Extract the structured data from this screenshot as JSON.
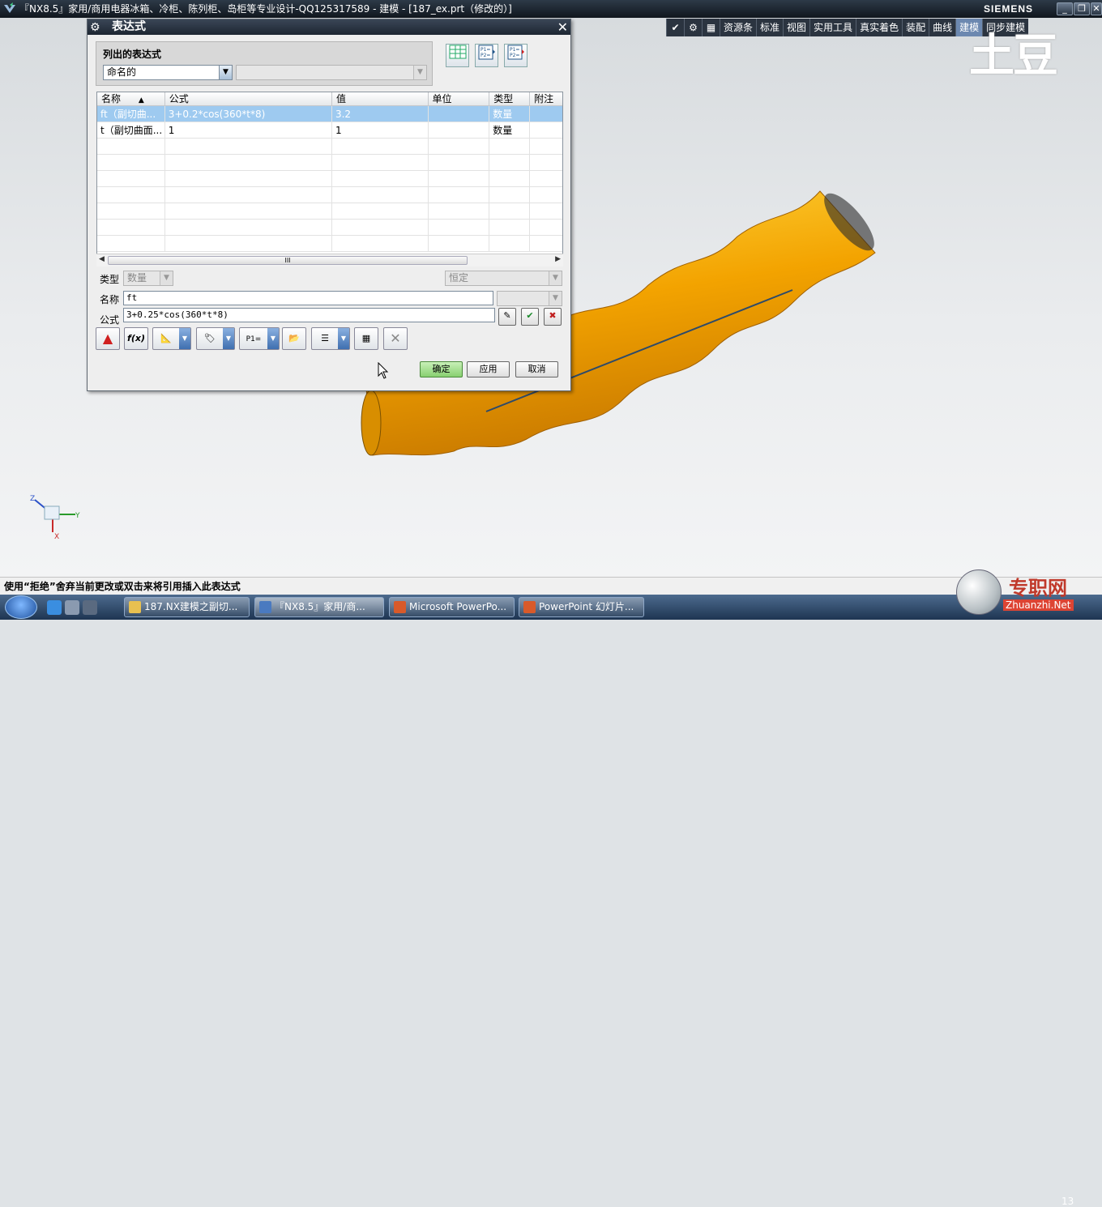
{
  "window": {
    "title": "『NX8.5』家用/商用电器冰箱、冷柜、陈列柜、岛柜等专业设计-QQ125317589 - 建模 - [187_ex.prt（修改的）]",
    "brand": "SIEMENS",
    "controls": [
      "_",
      "❐",
      "✕"
    ]
  },
  "ribbon": {
    "tabs": [
      "资源条",
      "标准",
      "视图",
      "实用工具",
      "真实着色",
      "装配",
      "曲线",
      "建模",
      "同步建模"
    ]
  },
  "watermark": "土豆",
  "dialog": {
    "title": "表达式",
    "close": "✕",
    "listed_group_label": "列出的表达式",
    "list_filter_value": "命名的",
    "list_filter_secondary": "",
    "table": {
      "headers": [
        "名称",
        "公式",
        "值",
        "单位",
        "类型",
        "附注"
      ],
      "rows": [
        {
          "name": "ft（副切曲...",
          "formula": "3+0.2*cos(360*t*8)",
          "value": "3.2",
          "unit": "",
          "type": "数量",
          "note": ""
        },
        {
          "name": "t（副切曲面...",
          "formula": "1",
          "value": "1",
          "unit": "",
          "type": "数量",
          "note": ""
        }
      ],
      "sort_indicator": "▲",
      "scroll_grip": "III"
    },
    "type_label": "类型",
    "type_value": "数量",
    "constant_value": "恒定",
    "name_label": "名称",
    "name_value": "ft",
    "formula_label": "公式",
    "formula_value": "3+0.25*cos(360*t*8)",
    "buttons": {
      "ok": "确定",
      "apply": "应用",
      "cancel": "取消"
    }
  },
  "status_bar": {
    "message": "使用“拒绝”舍弃当前更改或双击来将引用插入此表达式"
  },
  "taskbar": {
    "items": [
      "187.NX建模之副切...",
      "『NX8.5』家用/商...",
      "Microsoft PowerPo...",
      "PowerPoint 幻灯片..."
    ],
    "clock": "13"
  },
  "site_watermark": {
    "text": "专职网",
    "url": "Zhuanzhi.Net"
  },
  "axes": {
    "z": "Z",
    "y": "Y",
    "x": "X"
  },
  "colors": {
    "selection_row": "#9ecaf0",
    "tube": "#f0a800",
    "ok_button": "#88d070"
  }
}
